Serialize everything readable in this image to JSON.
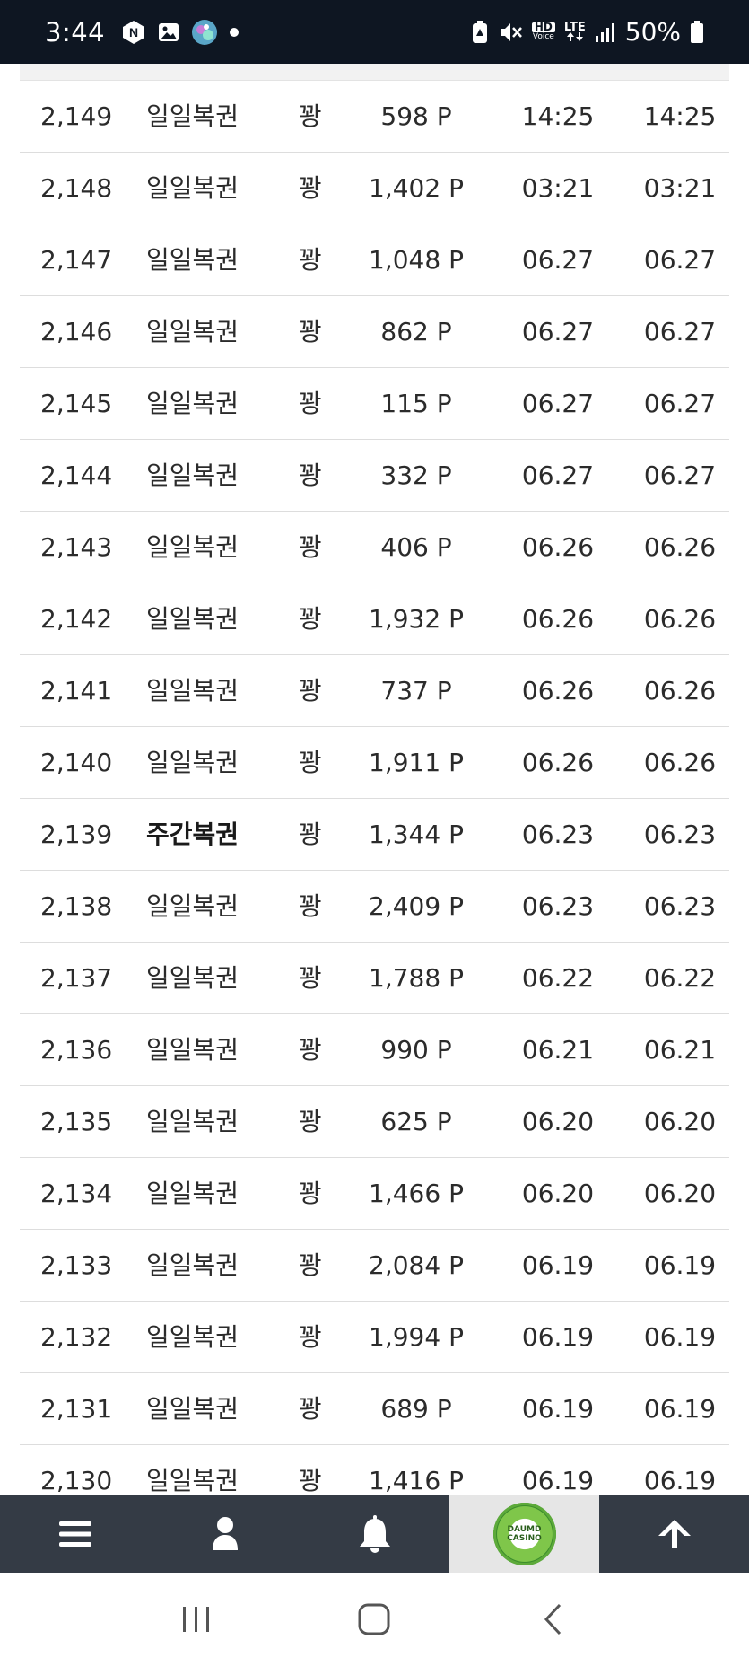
{
  "status_bar": {
    "time": "3:44",
    "battery": "50%",
    "hd_label": "HD",
    "voice_label": "Voice",
    "lte_label": "LTE",
    "icons": [
      "n-app-icon",
      "image-icon",
      "game-avatar-icon",
      "dot-icon",
      "battery-saver-icon",
      "mute-icon",
      "hd-voice-icon",
      "lte-icon",
      "signal-icon",
      "battery-icon"
    ]
  },
  "table": {
    "rows": [
      {
        "num": "2,149",
        "type": "일일복권",
        "result": "꽝",
        "points": "598 P",
        "date1": "14:25",
        "date2": "14:25"
      },
      {
        "num": "2,148",
        "type": "일일복권",
        "result": "꽝",
        "points": "1,402 P",
        "date1": "03:21",
        "date2": "03:21"
      },
      {
        "num": "2,147",
        "type": "일일복권",
        "result": "꽝",
        "points": "1,048 P",
        "date1": "06.27",
        "date2": "06.27"
      },
      {
        "num": "2,146",
        "type": "일일복권",
        "result": "꽝",
        "points": "862 P",
        "date1": "06.27",
        "date2": "06.27"
      },
      {
        "num": "2,145",
        "type": "일일복권",
        "result": "꽝",
        "points": "115 P",
        "date1": "06.27",
        "date2": "06.27"
      },
      {
        "num": "2,144",
        "type": "일일복권",
        "result": "꽝",
        "points": "332 P",
        "date1": "06.27",
        "date2": "06.27"
      },
      {
        "num": "2,143",
        "type": "일일복권",
        "result": "꽝",
        "points": "406 P",
        "date1": "06.26",
        "date2": "06.26"
      },
      {
        "num": "2,142",
        "type": "일일복권",
        "result": "꽝",
        "points": "1,932 P",
        "date1": "06.26",
        "date2": "06.26"
      },
      {
        "num": "2,141",
        "type": "일일복권",
        "result": "꽝",
        "points": "737 P",
        "date1": "06.26",
        "date2": "06.26"
      },
      {
        "num": "2,140",
        "type": "일일복권",
        "result": "꽝",
        "points": "1,911 P",
        "date1": "06.26",
        "date2": "06.26"
      },
      {
        "num": "2,139",
        "type": "주간복권",
        "result": "꽝",
        "points": "1,344 P",
        "date1": "06.23",
        "date2": "06.23"
      },
      {
        "num": "2,138",
        "type": "일일복권",
        "result": "꽝",
        "points": "2,409 P",
        "date1": "06.23",
        "date2": "06.23"
      },
      {
        "num": "2,137",
        "type": "일일복권",
        "result": "꽝",
        "points": "1,788 P",
        "date1": "06.22",
        "date2": "06.22"
      },
      {
        "num": "2,136",
        "type": "일일복권",
        "result": "꽝",
        "points": "990 P",
        "date1": "06.21",
        "date2": "06.21"
      },
      {
        "num": "2,135",
        "type": "일일복권",
        "result": "꽝",
        "points": "625 P",
        "date1": "06.20",
        "date2": "06.20"
      },
      {
        "num": "2,134",
        "type": "일일복권",
        "result": "꽝",
        "points": "1,466 P",
        "date1": "06.20",
        "date2": "06.20"
      },
      {
        "num": "2,133",
        "type": "일일복권",
        "result": "꽝",
        "points": "2,084 P",
        "date1": "06.19",
        "date2": "06.19"
      },
      {
        "num": "2,132",
        "type": "일일복권",
        "result": "꽝",
        "points": "1,994 P",
        "date1": "06.19",
        "date2": "06.19"
      },
      {
        "num": "2,131",
        "type": "일일복권",
        "result": "꽝",
        "points": "689 P",
        "date1": "06.19",
        "date2": "06.19"
      },
      {
        "num": "2,130",
        "type": "일일복권",
        "result": "꽝",
        "points": "1,416 P",
        "date1": "06.19",
        "date2": "06.19"
      }
    ]
  },
  "bottom_nav": {
    "items": [
      {
        "icon": "menu-icon"
      },
      {
        "icon": "user-icon"
      },
      {
        "icon": "bell-icon"
      },
      {
        "icon": "daumd-casino-logo",
        "logo_line1": "DAUMD",
        "logo_line2": "CASINO"
      },
      {
        "icon": "arrow-up-icon"
      }
    ]
  },
  "system_nav": {
    "items": [
      "recent-apps-icon",
      "home-icon",
      "back-icon"
    ]
  },
  "colors": {
    "status_bar_bg": "#0e1622",
    "bottom_nav_bg": "#343b45",
    "row_divider": "#dddddd",
    "text": "#2b2b2b",
    "logo_cell_bg": "#e6e6e6"
  }
}
